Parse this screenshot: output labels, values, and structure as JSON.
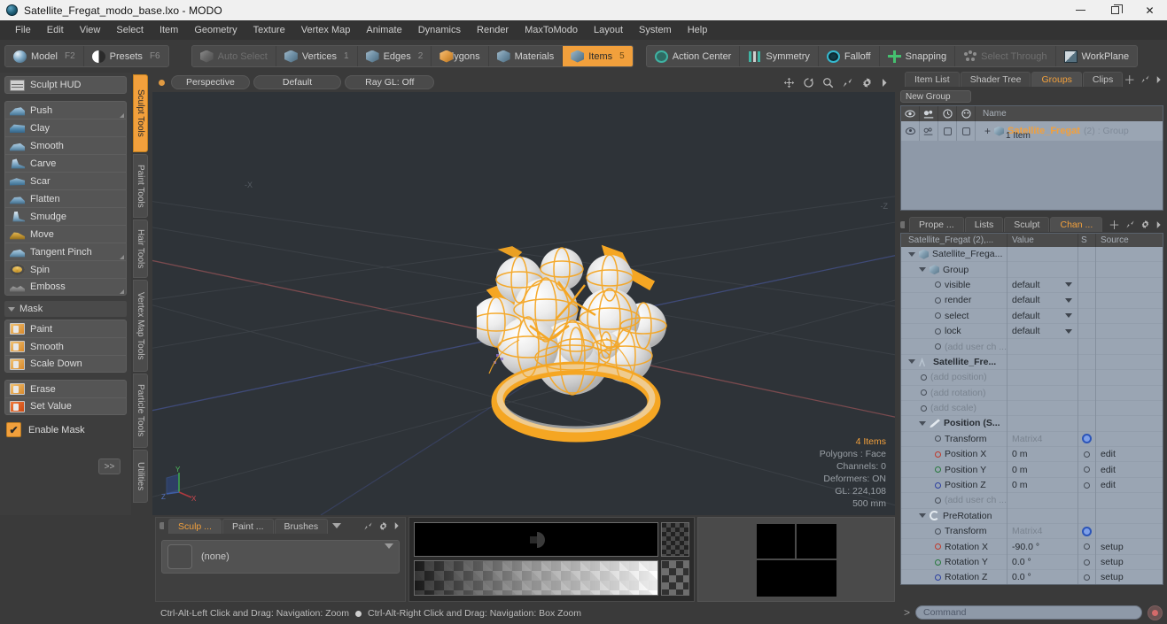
{
  "window": {
    "title": "Satellite_Fregat_modo_base.lxo - MODO",
    "app_icon": "modo-sphere-icon",
    "minimize": "minimize-icon",
    "maximize": "maximize-icon",
    "close": "close-icon"
  },
  "menubar": {
    "items": [
      "File",
      "Edit",
      "View",
      "Select",
      "Item",
      "Geometry",
      "Texture",
      "Vertex Map",
      "Animate",
      "Dynamics",
      "Render",
      "MaxToModo",
      "Layout",
      "System",
      "Help"
    ]
  },
  "modebar": {
    "left_group": [
      {
        "label": "Model",
        "shortcut": "F2",
        "icon": "sphere-icon"
      },
      {
        "label": "Presets",
        "shortcut": "F6",
        "icon": "half-sphere-icon"
      }
    ],
    "select_group": [
      {
        "label": "Auto Select",
        "num": "",
        "icon": "cube-icon",
        "state": "disabled"
      },
      {
        "label": "Vertices",
        "num": "1",
        "icon": "cube-icon",
        "state": "normal"
      },
      {
        "label": "Edges",
        "num": "2",
        "icon": "cube-icon",
        "state": "normal"
      },
      {
        "label": "Polygons",
        "num": "",
        "icon": "cube-icon",
        "state": "normal"
      },
      {
        "label": "Materials",
        "num": "",
        "icon": "cube-icon",
        "state": "normal"
      },
      {
        "label": "Items",
        "num": "5",
        "icon": "cube-icon",
        "state": "active"
      }
    ],
    "tool_group": [
      {
        "label": "Action Center",
        "icon": "action-center-icon",
        "state": "normal"
      },
      {
        "label": "Symmetry",
        "icon": "symmetry-icon",
        "state": "normal"
      },
      {
        "label": "Falloff",
        "icon": "falloff-icon",
        "state": "normal"
      },
      {
        "label": "Snapping",
        "icon": "snapping-icon",
        "state": "normal"
      },
      {
        "label": "Select Through",
        "icon": "select-through-icon",
        "state": "disabled"
      },
      {
        "label": "WorkPlane",
        "icon": "workplane-icon",
        "state": "normal"
      }
    ]
  },
  "sidebar": {
    "hud": {
      "label": "Sculpt HUD",
      "icon": "hud-icon"
    },
    "sculpt_tools": [
      {
        "label": "Push",
        "icon": "brush-push-icon",
        "has_corner": true
      },
      {
        "label": "Clay",
        "icon": "brush-clay-icon",
        "has_corner": false
      },
      {
        "label": "Smooth",
        "icon": "brush-smooth-icon",
        "has_corner": false
      },
      {
        "label": "Carve",
        "icon": "brush-carve-icon",
        "has_corner": false
      },
      {
        "label": "Scar",
        "icon": "brush-scar-icon",
        "has_corner": false
      },
      {
        "label": "Flatten",
        "icon": "brush-flatten-icon",
        "has_corner": false
      },
      {
        "label": "Smudge",
        "icon": "brush-smudge-icon",
        "has_corner": false
      },
      {
        "label": "Move",
        "icon": "brush-move-icon",
        "has_corner": false
      },
      {
        "label": "Tangent Pinch",
        "icon": "brush-pinch-icon",
        "has_corner": true
      },
      {
        "label": "Spin",
        "icon": "brush-spin-icon",
        "has_corner": false
      },
      {
        "label": "Emboss",
        "icon": "brush-emboss-icon",
        "has_corner": true
      }
    ],
    "mask_header": {
      "label": "Mask",
      "icon": "disclosure-triangle-icon"
    },
    "mask_tools": [
      {
        "label": "Paint",
        "icon": "mask-paint-icon"
      },
      {
        "label": "Smooth",
        "icon": "mask-smooth-icon"
      },
      {
        "label": "Scale Down",
        "icon": "mask-scale-down-icon"
      }
    ],
    "mask_tools2": [
      {
        "label": "Erase",
        "icon": "mask-erase-icon"
      },
      {
        "label": "Set Value",
        "icon": "mask-set-value-icon"
      }
    ],
    "enable_mask": {
      "label": "Enable Mask",
      "checked": true,
      "check_glyph": "✔"
    },
    "more_button": ">>",
    "vertical_tabs": [
      {
        "label": "Sculpt Tools",
        "active": true
      },
      {
        "label": "Paint Tools",
        "active": false
      },
      {
        "label": "Hair Tools",
        "active": false
      },
      {
        "label": "Vertex Map Tools",
        "active": false
      },
      {
        "label": "Particle Tools",
        "active": false
      },
      {
        "label": "Utilities",
        "active": false
      }
    ]
  },
  "viewport": {
    "header_tabs": [
      "Perspective",
      "Default",
      "Ray GL: Off"
    ],
    "header_icons": [
      "move-icon",
      "rotate-icon",
      "zoom-icon",
      "fit-icon",
      "gear-icon",
      "chevron-right-icon"
    ],
    "axis_labels": {
      "neg_x": "-X",
      "neg_z": "-Z"
    },
    "gizmo_axes": [
      "Y",
      "X",
      "Z"
    ],
    "stats": {
      "items": "4 Items",
      "polygons": "Polygons : Face",
      "channels": "Channels: 0",
      "deformers": "Deformers: ON",
      "gl": "GL: 224,108",
      "scale": "500 mm"
    },
    "model_color": "#f5a623",
    "background_color": "#2e3338"
  },
  "right_panel": {
    "top_tabs": [
      {
        "label": "Item List",
        "active": false
      },
      {
        "label": "Shader Tree",
        "active": false
      },
      {
        "label": "Groups",
        "active": true
      },
      {
        "label": "Clips",
        "active": false
      }
    ],
    "top_tab_icons": [
      "plus-icon",
      "expand-icon",
      "chevron-right-icon"
    ],
    "new_group_button": "New Group",
    "group_list": {
      "column_icons": [
        "eye-icon",
        "render-icon",
        "select-icon",
        "lock-icon"
      ],
      "name_header": "Name",
      "rows": [
        {
          "name": "Satellite_Fregat",
          "suffix": "(2) : Group",
          "sub": "1 Item",
          "icon": "group-cube-icon"
        }
      ]
    },
    "bottom_tabs": [
      {
        "label": "Prope ...",
        "active": false
      },
      {
        "label": "Lists",
        "active": false
      },
      {
        "label": "Sculpt",
        "active": false
      },
      {
        "label": "Chan ...",
        "active": true
      }
    ],
    "bottom_tab_icons": [
      "plus-icon",
      "expand-icon",
      "gear-icon",
      "chevron-right-icon"
    ],
    "channels": {
      "headers": [
        "Satellite_Fregat (2),...",
        "Value",
        "S",
        "Source"
      ],
      "rows": [
        {
          "indent": 0,
          "caret": true,
          "icon": "cube-icon",
          "name": "Satellite_Frega...",
          "value": "",
          "s": "",
          "source": "",
          "bold": false,
          "dim_name": false
        },
        {
          "indent": 1,
          "caret": true,
          "icon": "cube-icon",
          "name": "Group",
          "value": "",
          "s": "",
          "source": "",
          "bold": false,
          "dim_name": false
        },
        {
          "indent": 2,
          "caret": false,
          "icon": "channel-dot-icon",
          "name": "visible",
          "value": "default",
          "dropdown": true,
          "s": "",
          "source": "",
          "bold": false,
          "dim_name": false
        },
        {
          "indent": 2,
          "caret": false,
          "icon": "channel-dot-icon",
          "name": "render",
          "value": "default",
          "dropdown": true,
          "s": "",
          "source": "",
          "bold": false,
          "dim_name": false
        },
        {
          "indent": 2,
          "caret": false,
          "icon": "channel-dot-icon",
          "name": "select",
          "value": "default",
          "dropdown": true,
          "s": "",
          "source": "",
          "bold": false,
          "dim_name": false
        },
        {
          "indent": 2,
          "caret": false,
          "icon": "channel-dot-icon",
          "name": "lock",
          "value": "default",
          "dropdown": true,
          "s": "",
          "source": "",
          "bold": false,
          "dim_name": false
        },
        {
          "indent": 2,
          "caret": false,
          "icon": "channel-dot-icon",
          "name": "(add user ch  ...",
          "value": "",
          "s": "",
          "source": "",
          "bold": false,
          "dim_name": true
        },
        {
          "indent": 0,
          "caret": true,
          "icon": "mesh-icon",
          "name": "Satellite_Fre...",
          "value": "",
          "s": "",
          "source": "",
          "bold": true,
          "dim_name": false
        },
        {
          "indent": 1,
          "caret": false,
          "icon": "channel-dot-icon",
          "name": "(add position)",
          "value": "",
          "s": "",
          "source": "",
          "bold": false,
          "dim_name": true
        },
        {
          "indent": 1,
          "caret": false,
          "icon": "channel-dot-icon",
          "name": "(add rotation)",
          "value": "",
          "s": "",
          "source": "",
          "bold": false,
          "dim_name": true
        },
        {
          "indent": 1,
          "caret": false,
          "icon": "channel-dot-icon",
          "name": "(add scale)",
          "value": "",
          "s": "",
          "source": "",
          "bold": false,
          "dim_name": true
        },
        {
          "indent": 1,
          "caret": true,
          "icon": "position-pen-icon",
          "name": "Position (S...",
          "value": "",
          "s": "",
          "source": "",
          "bold": true,
          "dim_name": false
        },
        {
          "indent": 2,
          "caret": false,
          "icon": "channel-dot-icon",
          "name": "Transform",
          "value": "Matrix4",
          "s": "gear-blue-icon",
          "source": "",
          "bold": false,
          "dim_value": true
        },
        {
          "indent": 2,
          "caret": false,
          "icon": "axis-x-icon",
          "name": "Position X",
          "value": "0 m",
          "s": "circle-icon",
          "source": "edit",
          "bold": false
        },
        {
          "indent": 2,
          "caret": false,
          "icon": "axis-y-icon",
          "name": "Position Y",
          "value": "0 m",
          "s": "circle-icon",
          "source": "edit",
          "bold": false
        },
        {
          "indent": 2,
          "caret": false,
          "icon": "axis-z-icon",
          "name": "Position Z",
          "value": "0 m",
          "s": "circle-icon",
          "source": "edit",
          "bold": false
        },
        {
          "indent": 2,
          "caret": false,
          "icon": "channel-dot-icon",
          "name": "(add user ch  ...",
          "value": "",
          "s": "",
          "source": "",
          "bold": false,
          "dim_name": true
        },
        {
          "indent": 1,
          "caret": true,
          "icon": "prerotation-icon",
          "name": "PreRotation",
          "value": "",
          "s": "",
          "source": "",
          "bold": false
        },
        {
          "indent": 2,
          "caret": false,
          "icon": "channel-dot-icon",
          "name": "Transform",
          "value": "Matrix4",
          "s": "gear-blue-icon",
          "source": "",
          "bold": false,
          "dim_value": true
        },
        {
          "indent": 2,
          "caret": false,
          "icon": "axis-x-icon",
          "name": "Rotation X",
          "value": "-90.0 °",
          "s": "circle-icon",
          "source": "setup",
          "bold": false
        },
        {
          "indent": 2,
          "caret": false,
          "icon": "axis-y-icon",
          "name": "Rotation Y",
          "value": "0.0 °",
          "s": "circle-icon",
          "source": "setup",
          "bold": false
        },
        {
          "indent": 2,
          "caret": false,
          "icon": "axis-z-icon",
          "name": "Rotation Z",
          "value": "0.0 °",
          "s": "circle-icon",
          "source": "setup",
          "bold": false
        }
      ]
    }
  },
  "bottom_panels": {
    "left": {
      "tabs": [
        {
          "label": "Sculp ...",
          "active": true
        },
        {
          "label": "Paint ...",
          "active": false
        },
        {
          "label": "Brushes",
          "active": false
        }
      ],
      "tab_icons": [
        "chevron-down-icon",
        "expand-icon",
        "gear-icon",
        "chevron-right-icon"
      ],
      "preset_value": "(none)"
    },
    "middle": {
      "name": "brush-preview-gradient"
    },
    "right": {
      "name": "falloff-preview-quad"
    }
  },
  "statusbar": {
    "left_hint": "Ctrl-Alt-Left Click and Drag: Navigation: Zoom",
    "right_hint": "Ctrl-Alt-Right Click and Drag: Navigation: Box Zoom",
    "command_placeholder": "Command",
    "command_prompt": ">",
    "record_icon": "record-icon"
  }
}
